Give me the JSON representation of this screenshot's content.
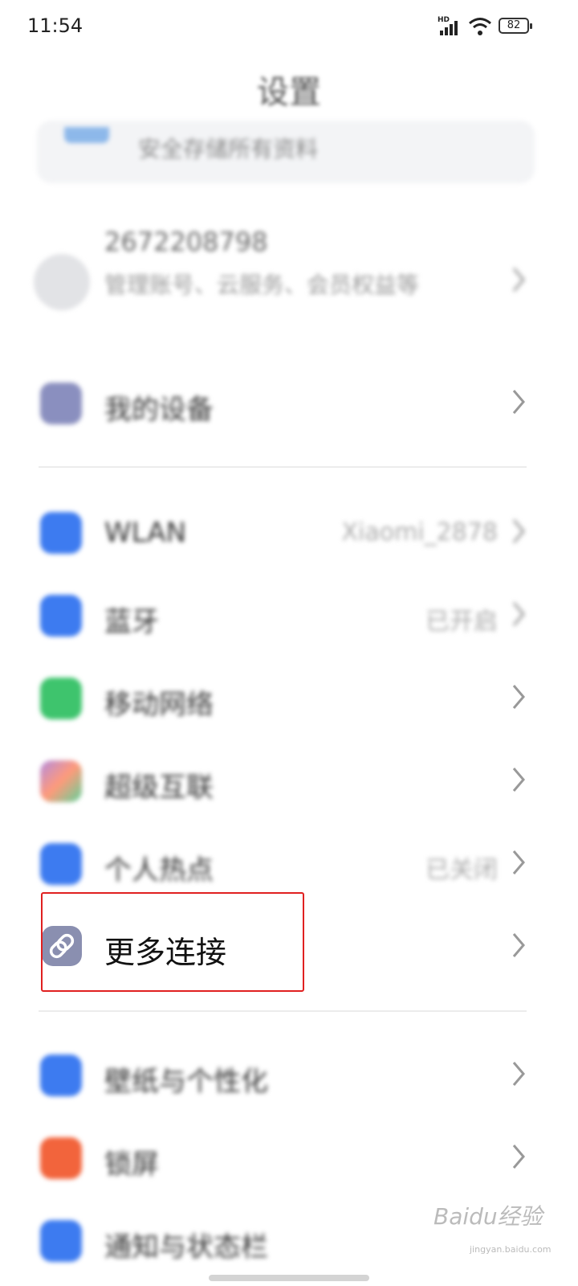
{
  "status_bar": {
    "time": "11:54",
    "network_badge": "HD",
    "battery": "82"
  },
  "header": {
    "title": "设置"
  },
  "top_card": {
    "text": "安全存储所有资料"
  },
  "account": {
    "number": "2672208798",
    "description": "管理账号、云服务、会员权益等"
  },
  "items": [
    {
      "label": "我的设备",
      "value": "",
      "icon": "device-icon",
      "color": "#8a8fbf"
    },
    {
      "label": "WLAN",
      "value": "Xiaomi_2878",
      "icon": "wifi-icon",
      "color": "#3d7bf0"
    },
    {
      "label": "蓝牙",
      "value": "已开启",
      "icon": "bluetooth-icon",
      "color": "#3d7bf0"
    },
    {
      "label": "移动网络",
      "value": "",
      "icon": "cellular-icon",
      "color": "#3ec46d"
    },
    {
      "label": "超级互联",
      "value": "",
      "icon": "super-connect-icon",
      "color": "#b48ce0"
    },
    {
      "label": "个人热点",
      "value": "已关闭",
      "icon": "hotspot-icon",
      "color": "#3d7bf0"
    },
    {
      "label": "更多连接",
      "value": "",
      "icon": "link-icon",
      "color": "#8a8fb0"
    },
    {
      "label": "壁纸与个性化",
      "value": "",
      "icon": "wallpaper-icon",
      "color": "#3d7bf0"
    },
    {
      "label": "锁屏",
      "value": "",
      "icon": "lock-icon",
      "color": "#f2643c"
    },
    {
      "label": "通知与状态栏",
      "value": "",
      "icon": "notification-icon",
      "color": "#3d7bf0"
    }
  ],
  "watermark": {
    "text": "Baidu经验",
    "sub": "jingyan.baidu.com"
  }
}
